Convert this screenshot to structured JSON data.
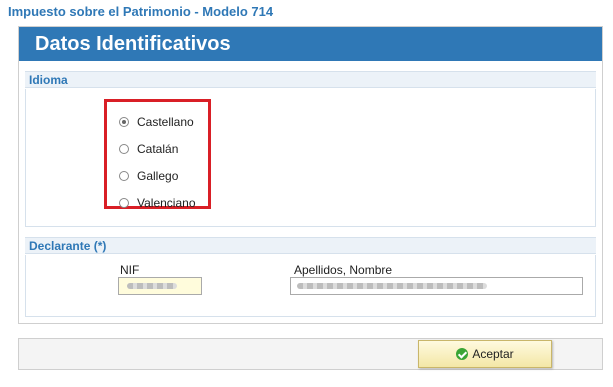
{
  "app": {
    "title": "Impuesto sobre el Patrimonio - Modelo 714"
  },
  "header": {
    "title": "Datos Identificativos"
  },
  "idioma": {
    "section_title": "Idioma",
    "selected": "Castellano",
    "options": [
      {
        "label": "Castellano",
        "checked": true
      },
      {
        "label": "Catalán",
        "checked": false
      },
      {
        "label": "Gallego",
        "checked": false
      },
      {
        "label": "Valenciano",
        "checked": false
      }
    ]
  },
  "declarante": {
    "section_title": "Declarante (*)",
    "nif_label": "NIF",
    "name_label": "Apellidos, Nombre"
  },
  "footer": {
    "accept_label": "Aceptar"
  },
  "colors": {
    "accent": "#2f78b6",
    "highlight_border": "#d91f26",
    "nif_bg": "#fffcdc"
  }
}
